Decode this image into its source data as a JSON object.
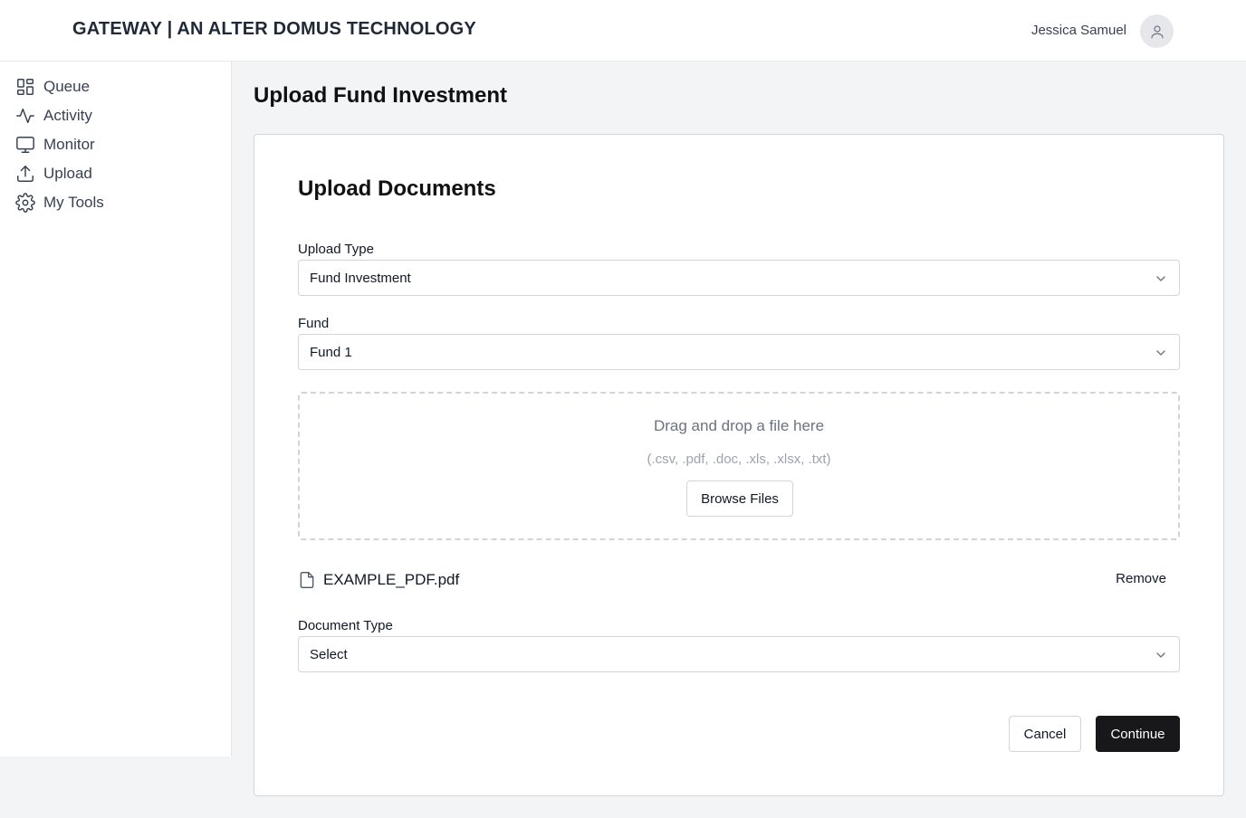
{
  "header": {
    "brand": "GATEWAY | AN ALTER DOMUS TECHNOLOGY",
    "user_name": "Jessica Samuel",
    "avatar_icon": "user-icon"
  },
  "sidebar": {
    "items": [
      {
        "label": "Queue",
        "icon": "grid-icon"
      },
      {
        "label": "Activity",
        "icon": "activity-icon"
      },
      {
        "label": "Monitor",
        "icon": "monitor-icon"
      },
      {
        "label": "Upload",
        "icon": "upload-icon"
      },
      {
        "label": "My Tools",
        "icon": "gear-icon"
      }
    ]
  },
  "page": {
    "title": "Upload Fund Investment"
  },
  "form": {
    "title": "Upload Documents",
    "upload_type": {
      "label": "Upload Type",
      "value": "Fund Investment"
    },
    "fund": {
      "label": "Fund",
      "value": "Fund 1"
    },
    "dropzone": {
      "text": "Drag and drop a file here",
      "formats": "(.csv, .pdf, .doc, .xls, .xlsx, .txt)",
      "browse_label": "Browse Files"
    },
    "file": {
      "name": "EXAMPLE_PDF.pdf",
      "remove_label": "Remove",
      "icon": "file-icon"
    },
    "document_type": {
      "label": "Document Type",
      "value": "Select"
    },
    "cancel_label": "Cancel",
    "continue_label": "Continue"
  },
  "colors": {
    "background": "#f3f4f6",
    "primary_button": "#18181b",
    "border": "#d1d5db"
  }
}
